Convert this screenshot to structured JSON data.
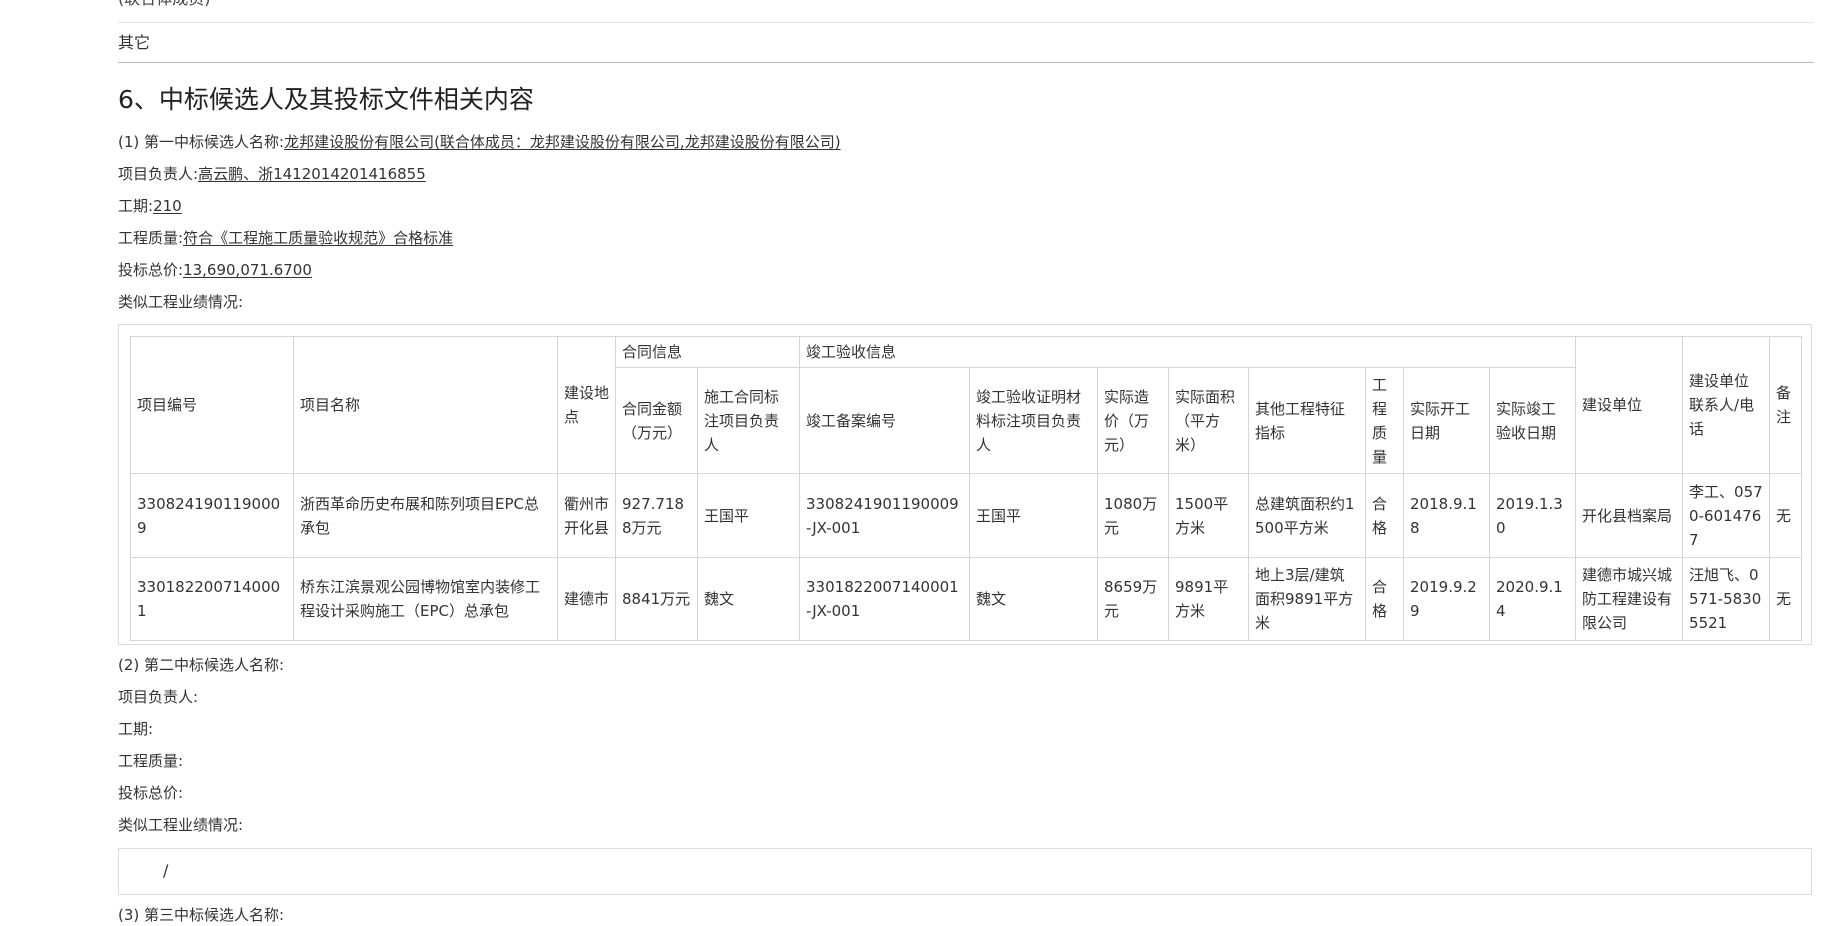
{
  "top_cut_text": "(联合体成员)",
  "other_row": "其它",
  "section_title": "6、中标候选人及其投标文件相关内容",
  "candidate1": {
    "name_label": "(1) 第一中标候选人名称:",
    "name_value": "龙邦建设股份有限公司(联合体成员：龙邦建设股份有限公司,龙邦建设股份有限公司)",
    "manager_label": "项目负责人:",
    "manager_value": "高云鹏、浙1412014201416855",
    "period_label": "工期:",
    "period_value": "210",
    "quality_label": "工程质量:",
    "quality_value": "符合《工程施工质量验收规范》合格标准",
    "price_label": "投标总价:",
    "price_value": "13,690,071.6700",
    "perf_label": "类似工程业绩情况:"
  },
  "table": {
    "headers": {
      "project_no": "项目编号",
      "project_name": "项目名称",
      "location": "建设地点",
      "contract_group": "合同信息",
      "completion_group": "竣工验收信息",
      "contract_amount": "合同金额（万元）",
      "contract_manager": "施工合同标注项目负责人",
      "record_no": "竣工备案编号",
      "proof_manager": "竣工验收证明材料标注项目负责人",
      "actual_cost": "实际造价（万元）",
      "actual_area": "实际面积（平方米）",
      "other_features": "其他工程特征指标",
      "quality": "工程质量",
      "start_date": "实际开工日期",
      "accept_date": "实际竣工验收日期",
      "builder": "建设单位",
      "contact": "建设单位联系人/电话",
      "remark": "备注"
    },
    "rows": [
      {
        "project_no": "3308241901190009",
        "project_name": "浙西革命历史布展和陈列项目EPC总承包",
        "location": "衢州市开化县",
        "contract_amount": "927.7188万元",
        "contract_manager": "王国平",
        "record_no": "3308241901190009-JX-001",
        "proof_manager": "王国平",
        "actual_cost": "1080万元",
        "actual_area": "1500平方米",
        "other_features": "总建筑面积约1500平方米",
        "quality": "合格",
        "start_date": "2018.9.18",
        "accept_date": "2019.1.30",
        "builder": "开化县档案局",
        "contact": "李工、0570-6014767",
        "remark": "无"
      },
      {
        "project_no": "3301822007140001",
        "project_name": "桥东江滨景观公园博物馆室内装修工程设计采购施工（EPC）总承包",
        "location": "建德市",
        "contract_amount": "8841万元",
        "contract_manager": "魏文",
        "record_no": "3301822007140001-JX-001",
        "proof_manager": "魏文",
        "actual_cost": "8659万元",
        "actual_area": "9891平方米",
        "other_features": "地上3层/建筑面积9891平方米",
        "quality": "合格",
        "start_date": "2019.9.29",
        "accept_date": "2020.9.14",
        "builder": "建德市城兴城防工程建设有限公司",
        "contact": "汪旭飞、0571-58305521",
        "remark": "无"
      }
    ]
  },
  "candidate2": {
    "name_label": "(2) 第二中标候选人名称:",
    "manager_label": "项目负责人:",
    "period_label": "工期:",
    "quality_label": "工程质量:",
    "price_label": "投标总价:",
    "perf_label": "类似工程业绩情况:",
    "perf_value": "/"
  },
  "candidate3": {
    "name_label": "(3) 第三中标候选人名称:"
  }
}
